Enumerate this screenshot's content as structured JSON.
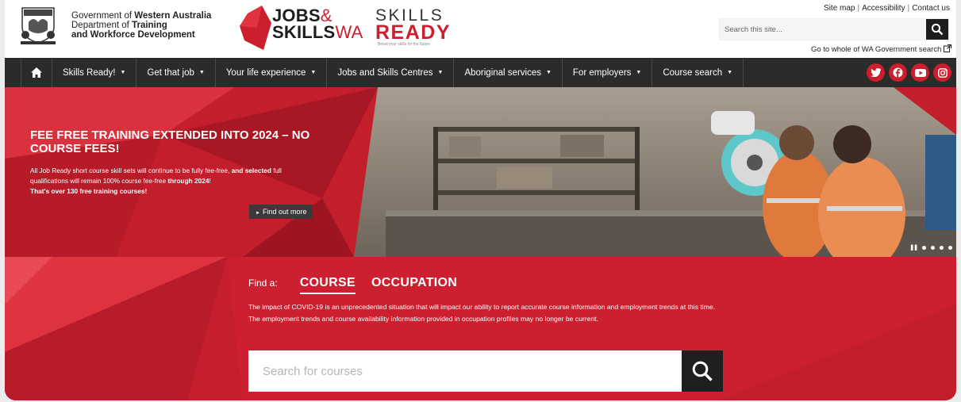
{
  "header": {
    "gov_line1_prefix": "Government of ",
    "gov_line1_bold": "Western Australia",
    "gov_line2_prefix": "Department of ",
    "gov_line2_bold": "Training",
    "gov_line3": "and Workforce Development",
    "jobs_line1": "JOBS",
    "jobs_amp": "&",
    "jobs_line2": "SKILLS",
    "jobs_wa": "WA",
    "skills_line1": "SKILLS",
    "skills_line2": "READY",
    "skills_tagline": "Boost your skills for the future",
    "toplinks": [
      "Site map",
      "Accessibility",
      "Contact us"
    ],
    "search_placeholder": "Search this site...",
    "wa_search_label": "Go to whole of WA Government search"
  },
  "nav": {
    "home_icon": "home-icon",
    "items": [
      {
        "label": "Skills Ready!"
      },
      {
        "label": "Get that job"
      },
      {
        "label": "Your life experience"
      },
      {
        "label": "Jobs and Skills Centres"
      },
      {
        "label": "Aboriginal services"
      },
      {
        "label": "For employers"
      },
      {
        "label": "Course search"
      }
    ],
    "socials": [
      "twitter-icon",
      "facebook-icon",
      "youtube-icon",
      "instagram-icon"
    ]
  },
  "hero": {
    "title": "FEE FREE TRAINING EXTENDED INTO 2024 – NO COURSE FEES!",
    "body_1": "All Job Ready short course skill sets will continue to be fully fee-free, ",
    "body_2": "and selected",
    "body_3": " full qualifications will remain 100% course fee-free ",
    "body_4": "through 2024",
    "body_5": "! ",
    "body_6": "That's over 130 free training courses!",
    "button_label": "Find out more",
    "slide_count": 4,
    "active_slide": 1
  },
  "finder": {
    "label": "Find a:",
    "tabs": [
      "COURSE",
      "OCCUPATION"
    ],
    "active_tab": "COURSE",
    "notice": "The impact of COVID-19 is an unprecedented situation that will impact our ability to report accurate course information and employment trends at this time. The employment trends and course availability information provided in occupation profiles may no longer be current.",
    "search_placeholder": "Search for courses"
  },
  "colors": {
    "brand_red": "#cc1f2d",
    "nav_dark": "#2b2b2b"
  }
}
